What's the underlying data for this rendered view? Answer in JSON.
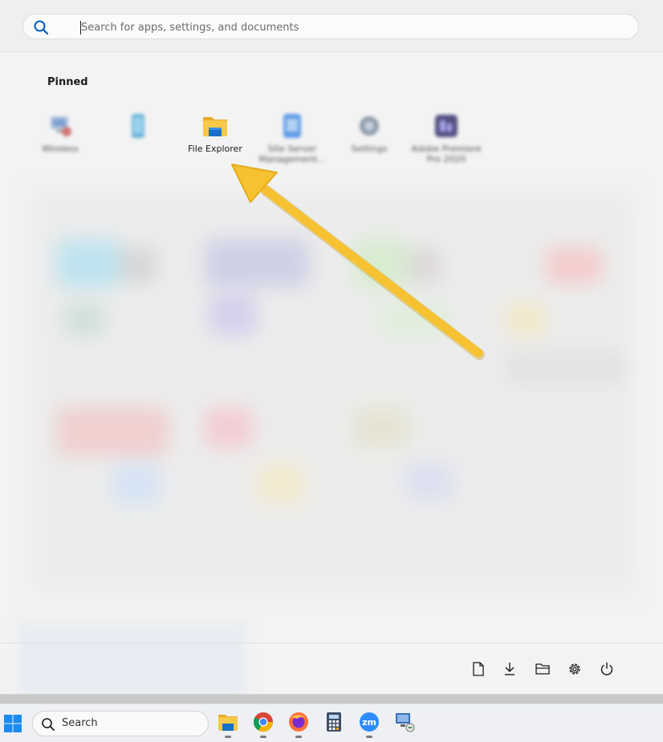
{
  "search": {
    "placeholder": "Search for apps, settings, and documents",
    "icon": "search-icon"
  },
  "pinned": {
    "title": "Pinned",
    "apps": [
      {
        "label": "Wireless",
        "icon": "network-icon",
        "blurred": true
      },
      {
        "label": "",
        "icon": "phone-icon",
        "blurred": true
      },
      {
        "label": "File Explorer",
        "icon": "folder-icon",
        "blurred": false
      },
      {
        "label": "Site Server Management...",
        "icon": "app-icon",
        "blurred": true
      },
      {
        "label": "Settings",
        "icon": "gear-icon",
        "blurred": true
      },
      {
        "label": "Adobe Premiere Pro 2020",
        "icon": "premiere-icon",
        "blurred": true
      }
    ]
  },
  "footer": {
    "buttons": [
      {
        "name": "documents-button",
        "icon": "document-icon"
      },
      {
        "name": "downloads-button",
        "icon": "download-icon"
      },
      {
        "name": "file-explorer-button",
        "icon": "folder-icon"
      },
      {
        "name": "settings-button",
        "icon": "gear-icon"
      },
      {
        "name": "power-button",
        "icon": "power-icon"
      }
    ]
  },
  "taskbar": {
    "search_label": "Search",
    "apps": [
      {
        "name": "file-explorer",
        "icon": "folder-icon"
      },
      {
        "name": "chrome",
        "icon": "chrome-icon"
      },
      {
        "name": "firefox",
        "icon": "firefox-icon"
      },
      {
        "name": "calculator",
        "icon": "calculator-icon"
      },
      {
        "name": "zoom",
        "icon": "zoom-icon",
        "text": "zm"
      },
      {
        "name": "network-monitor",
        "icon": "computer-icon"
      }
    ]
  },
  "colors": {
    "accent": "#005fb8",
    "arrow": "#f6c231",
    "folder": "#f4c430"
  }
}
